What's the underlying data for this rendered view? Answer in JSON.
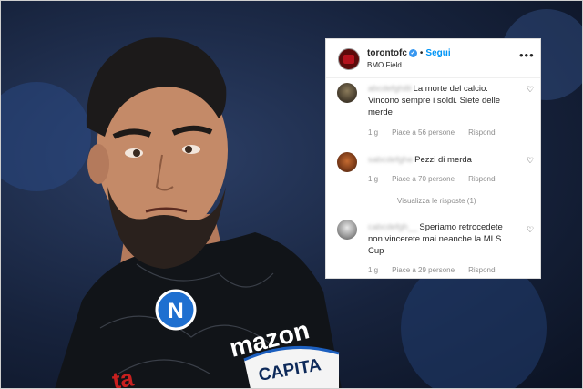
{
  "post": {
    "username": "torontofc",
    "follow_label": "Segui",
    "location": "BMO Field",
    "more_glyph": "•••"
  },
  "comments": [
    {
      "author_blurred": "abcdefghilli",
      "text": "La morte del calcio. Vincono sempre i soldi. Siete delle merde",
      "time": "1 g",
      "likes": "Piace a 56 persone",
      "reply_label": "Rispondi"
    },
    {
      "author_blurred": "sabcdefghe",
      "text": "Pezzi di merda",
      "time": "1 g",
      "likes": "Piace a 70 persone",
      "reply_label": "Rispondi",
      "view_replies": "Visualizza le risposte (1)"
    },
    {
      "author_blurred": "cabcdefgh__",
      "text": "Speriamo retrocedete non vincerete mai neanche la MLS Cup",
      "time": "1 g",
      "likes": "Piace a 29 persone",
      "reply_label": "Rispondi"
    }
  ],
  "photo": {
    "jersey_sponsor": "mazon",
    "armband": "CAPITA",
    "badge_letter": "N"
  }
}
